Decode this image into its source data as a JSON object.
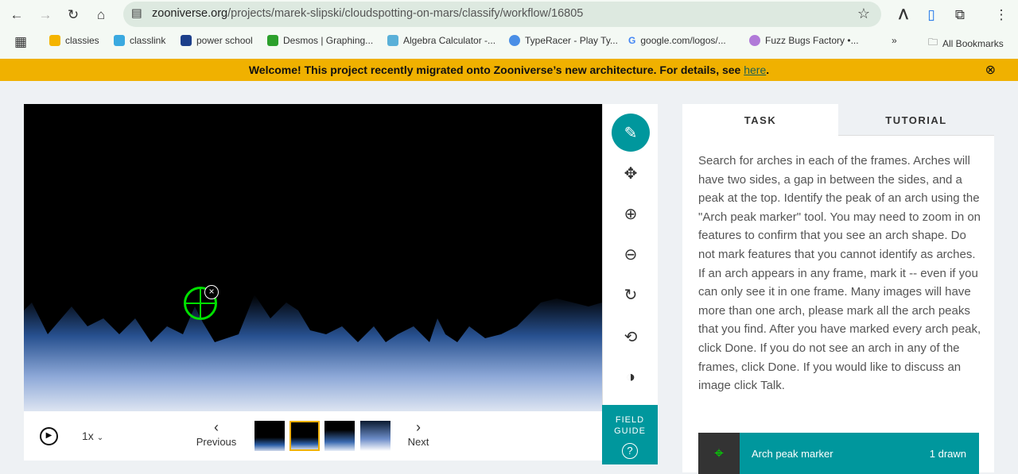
{
  "browser": {
    "url_host": "zooniverse.org",
    "url_path": "/projects/marek-slipski/cloudspotting-on-mars/classify/workflow/16805",
    "bookmarks": [
      "classies",
      "classlink",
      "power school",
      "Desmos | Graphing...",
      "Algebra Calculator -...",
      "TypeRacer - Play Ty...",
      "google.com/logos/...",
      "Fuzz Bugs Factory •..."
    ],
    "more": "»",
    "all_bookmarks": "All Bookmarks"
  },
  "banner": {
    "text": "Welcome! This project recently migrated onto Zooniverse’s new architecture. For details, see ",
    "link": "here",
    "end": "."
  },
  "controls": {
    "speed": "1x",
    "previous": "Previous",
    "next": "Next"
  },
  "field_guide": {
    "line1": "FIELD",
    "line2": "GUIDE"
  },
  "panel": {
    "tabs": [
      "TASK",
      "TUTORIAL"
    ],
    "instructions": "Search for arches in each of the frames. Arches will have two sides, a gap in between the sides, and a peak at the top. Identify the peak of an arch using the \"Arch peak marker\" tool. You may need to zoom in on features to confirm that you see an arch shape. Do not mark features that you cannot identify as arches. If an arch appears in any frame, mark it -- even if you can only see it in one frame. Many images will have more than one arch, please mark all the arch peaks that you find. After you have marked every arch peak, click Done. If you do not see an arch in any of the frames, click Done. If you would like to discuss an image click Talk.",
    "marker_label": "Arch peak marker",
    "marker_count": "1 drawn"
  },
  "colors": {
    "teal": "#00979d",
    "banner": "#f0b100",
    "marker": "#00e000"
  }
}
